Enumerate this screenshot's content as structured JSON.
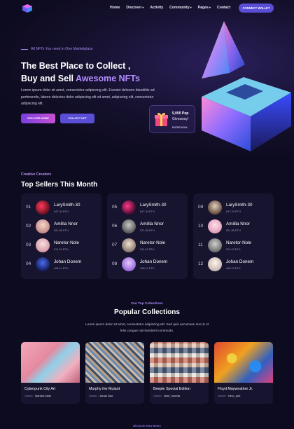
{
  "nav": {
    "items": [
      {
        "label": "Home",
        "dropdown": false
      },
      {
        "label": "Discover",
        "dropdown": true
      },
      {
        "label": "Activity",
        "dropdown": false
      },
      {
        "label": "Community",
        "dropdown": true
      },
      {
        "label": "Pages",
        "dropdown": true
      },
      {
        "label": "Contact",
        "dropdown": false
      }
    ],
    "wallet_button": "CONNECT WALLET"
  },
  "hero": {
    "tag": "All NFTs You need in One Marketplace",
    "title_line1": "The Best Place to Collect ,",
    "title_line2_plain": "Buy and Sell ",
    "title_line2_accent": "Awesome NFTs",
    "description": "Lorem ipsum dolor sit amet, consectetur adipiscing elit. Eveniet dolorem blanditiis ad perferendis, labore delectus dolor adipiscing elit sit amet, adipiscing elit, consectetur adipiscing elit.",
    "explore_button": "EXPLORE MORE",
    "collect_button": "COLLECT NFT",
    "giveaway_count": "5,000 Pop",
    "giveaway_label": "Giveaway!",
    "giveaway_sub": "ENTER NOW"
  },
  "sellers": {
    "tag": "Creative Creators",
    "title": "Top Sellers This Month",
    "columns": [
      [
        {
          "num": "01",
          "name": "LarySmith-30",
          "eth": "647.34 ETH"
        },
        {
          "num": "02",
          "name": "Amillia Nnor",
          "eth": "521.85 ETH"
        },
        {
          "num": "03",
          "name": "Naretor-Nole",
          "eth": "511.45 ETH"
        },
        {
          "num": "04",
          "name": "Johan Donem",
          "eth": "498.11 ETH"
        }
      ],
      [
        {
          "num": "05",
          "name": "LarySmith-30",
          "eth": "647.34 ETH"
        },
        {
          "num": "06",
          "name": "Amillia Nnor",
          "eth": "521.85 ETH"
        },
        {
          "num": "07",
          "name": "Naretor-Nole",
          "eth": "511.45 ETH"
        },
        {
          "num": "08",
          "name": "Johan Donem",
          "eth": "498.11 ETH"
        }
      ],
      [
        {
          "num": "09",
          "name": "LarySmith-30",
          "eth": "647.34 ETH"
        },
        {
          "num": "10",
          "name": "Amillia Nnor",
          "eth": "521.85 ETH"
        },
        {
          "num": "11",
          "name": "Naretor-Nole",
          "eth": "511.45 ETH"
        },
        {
          "num": "12",
          "name": "Johan Donem",
          "eth": "498.11 ETH"
        }
      ]
    ]
  },
  "collections": {
    "tag": "Our Top Collections",
    "title": "Popular Collections",
    "description": "Lorem ipsum dolor sit amet, consectetur adipiscing elit. Sed quis accumsan nisi Ut ut felis congue nisl hendrerit commodo.",
    "owner_label": "Owner : ",
    "items": [
      {
        "name": "Cyberpunk City Art",
        "owner": "Naretor-Nole"
      },
      {
        "name": "Murphy the Mutant",
        "owner": "Johan Doe"
      },
      {
        "name": "Beeple Special Edition",
        "owner": "Nole_moreta"
      },
      {
        "name": "Floyd Mayweather Jr.",
        "owner": "Kero_one"
      }
    ]
  },
  "discover_tag": "Discover New Items",
  "colors": {
    "background": "#0d0b1f",
    "accent_purple": "#b48cff",
    "button_blue": "#5a4dd6",
    "card_bg": "#171430"
  }
}
